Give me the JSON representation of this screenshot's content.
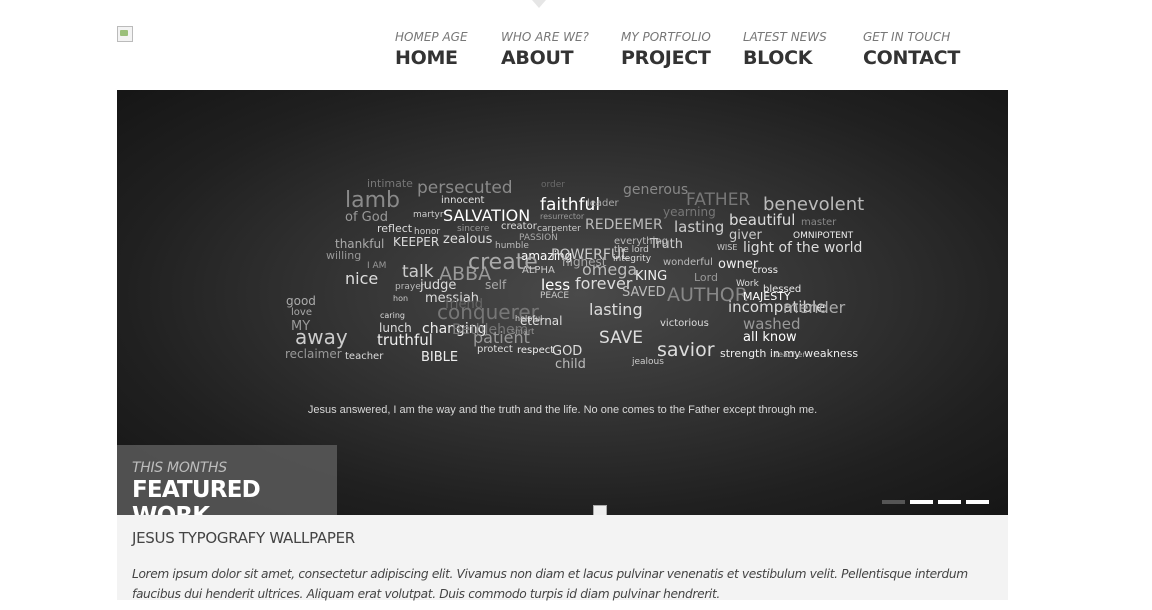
{
  "nav": {
    "items": [
      {
        "sub": "HOMEP AGE",
        "label": "HOME"
      },
      {
        "sub": "WHO ARE WE?",
        "label": "ABOUT"
      },
      {
        "sub": "MY PORTFOLIO",
        "label": "PROJECT"
      },
      {
        "sub": "LATEST NEWS",
        "label": "BLOCK"
      },
      {
        "sub": "GET IN TOUCH",
        "label": "CONTACT"
      }
    ]
  },
  "slider": {
    "words": [
      "intimate",
      "persecuted",
      "order",
      "generous",
      "lamb",
      "innocent",
      "faithful",
      "leader",
      "FATHER",
      "benevolent",
      "of God",
      "martyr",
      "SALVATION",
      "resurrector",
      "yearning",
      "beautiful",
      "master",
      "reflect",
      "honor",
      "sincere",
      "creator",
      "carpenter",
      "REDEEMER",
      "lasting",
      "giver",
      "OMNIPOTENT",
      "thankful",
      "KEEPER",
      "zealous",
      "PASSION",
      "humble",
      "everything",
      "Truth",
      "the lord",
      "WISE",
      "light of the world",
      "willing",
      "amazing",
      "POWERFUL",
      "highest",
      "integrity",
      "wonderful",
      "owner",
      "I AM",
      "talk",
      "ABBA",
      "create",
      "ALPHA",
      "omega",
      "KING",
      "Lord",
      "cross",
      "nice",
      "prayer",
      "judge",
      "self",
      "less",
      "forever",
      "Work",
      "blessed",
      "good",
      "hon",
      "messiah",
      "friend",
      "PEACE",
      "SAVED",
      "AUTHOR",
      "MAJESTY",
      "love",
      "caring",
      "conquerer",
      "helpful",
      "lasting",
      "incompatible",
      "mender",
      "MY",
      "lunch",
      "changing",
      "Bethlehem",
      "eternal",
      "smart",
      "victorious",
      "washed",
      "away",
      "truthful",
      "patient",
      "SAVE",
      "all know",
      "reclaimer",
      "teacher",
      "BIBLE",
      "protect",
      "respect",
      "GOD",
      "child",
      "savior",
      "jealous",
      "strength in my weakness",
      "teacher"
    ],
    "quote": "Jesus answered,    I am the way and the truth and the life. No one comes to the Father except through me.",
    "featured": {
      "sub": "THIS MONTHS",
      "title": "FEATURED WORK"
    },
    "dots": [
      {
        "active": true
      },
      {
        "active": false
      },
      {
        "active": false
      },
      {
        "active": false
      }
    ]
  },
  "info": {
    "title": "JESUS TYPOGRAFY WALLPAPER",
    "text": "Lorem ipsum dolor sit amet, consectetur adipiscing elit. Vivamus non diam et lacus pulvinar venenatis et vestibulum velit. Pellentisque interdum faucibus dui henderit ultrices. Aliquam erat volutpat. Duis commodo turpis id diam pulvinar hendrerit."
  }
}
